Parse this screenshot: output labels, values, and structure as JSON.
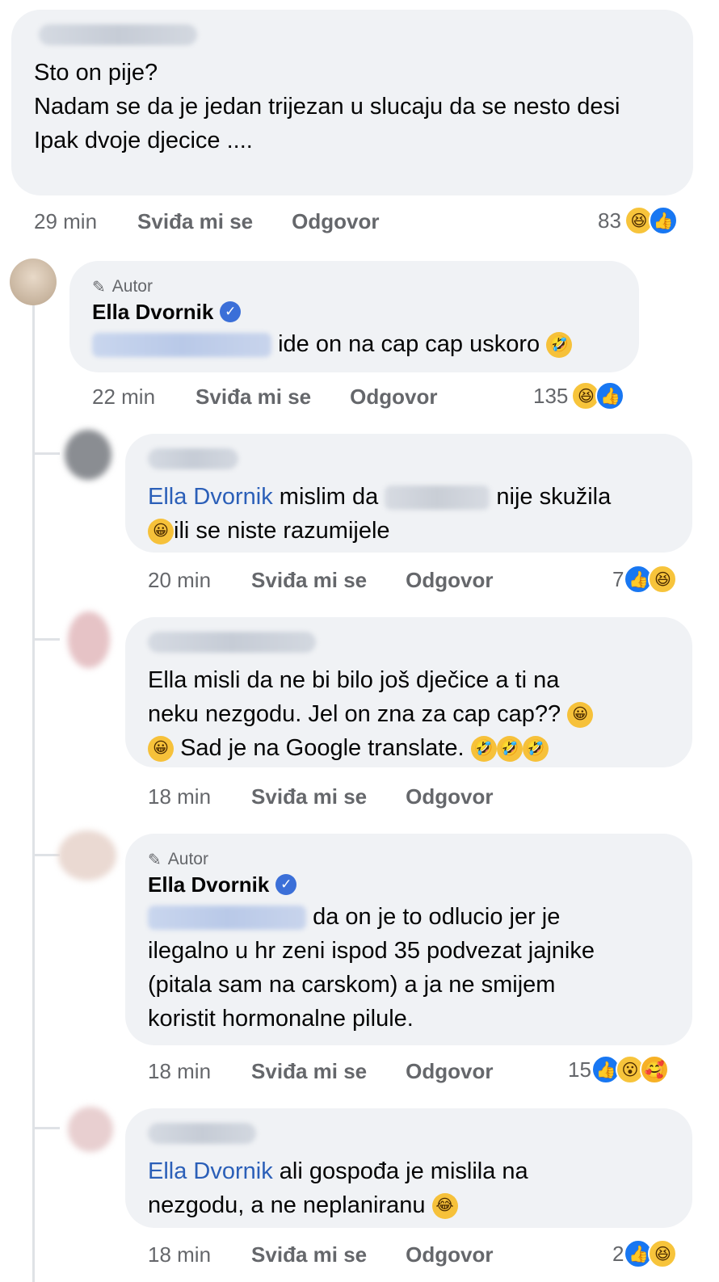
{
  "comments": [
    {
      "text_lines": [
        "Sto on pije?",
        "Nadam se da je jedan trijezan u slucaju da se nesto desi",
        "Ipak dvoje djecice ...."
      ],
      "time": "29 min",
      "like_label": "Sviđa mi se",
      "reply_label": "Odgovor",
      "reaction_count": "83",
      "reactions": [
        "haha",
        "like"
      ]
    },
    {
      "author_badge": "Autor",
      "name": "Ella Dvornik",
      "text": "ide on na cap cap uskoro",
      "time": "22 min",
      "like_label": "Sviđa mi se",
      "reply_label": "Odgovor",
      "reaction_count": "135",
      "reactions": [
        "haha",
        "like"
      ]
    },
    {
      "mention": "Ella Dvornik",
      "text_a": "mislim da",
      "text_b": "nije skužila",
      "text_c": "ili se niste razumijele",
      "time": "20 min",
      "like_label": "Sviđa mi se",
      "reply_label": "Odgovor",
      "reaction_count": "7",
      "reactions": [
        "like",
        "haha"
      ]
    },
    {
      "text_l1": "Ella misli da ne bi bilo još dječice a ti na",
      "text_l2": "neku nezgodu. Jel on zna za cap cap??",
      "text_l3": "Sad je na Google translate.",
      "time": "18 min",
      "like_label": "Sviđa mi se",
      "reply_label": "Odgovor"
    },
    {
      "author_badge": "Autor",
      "name": "Ella Dvornik",
      "text_l1": "da on je to odlucio jer je",
      "text_l2": "ilegalno u hr zeni ispod 35 podvezat jajnike",
      "text_l3": "(pitala sam na carskom) a ja ne smijem",
      "text_l4": "koristit hormonalne pilule.",
      "time": "18 min",
      "like_label": "Sviđa mi se",
      "reply_label": "Odgovor",
      "reaction_count": "15",
      "reactions": [
        "like",
        "wow",
        "care"
      ]
    },
    {
      "mention": "Ella Dvornik",
      "text_l1": "ali gospođa je mislila na",
      "text_l2": "nezgodu, a ne neplaniranu",
      "time": "18 min",
      "like_label": "Sviđa mi se",
      "reply_label": "Odgovor",
      "reaction_count": "2",
      "reactions": [
        "like",
        "haha"
      ]
    }
  ],
  "icons": {
    "author": "microphone-icon",
    "verified": "verified-check-icon"
  },
  "colors": {
    "bubble": "#f0f2f5",
    "mention": "#2b5fb8",
    "like": "#1877f2",
    "muted": "#65676b"
  }
}
